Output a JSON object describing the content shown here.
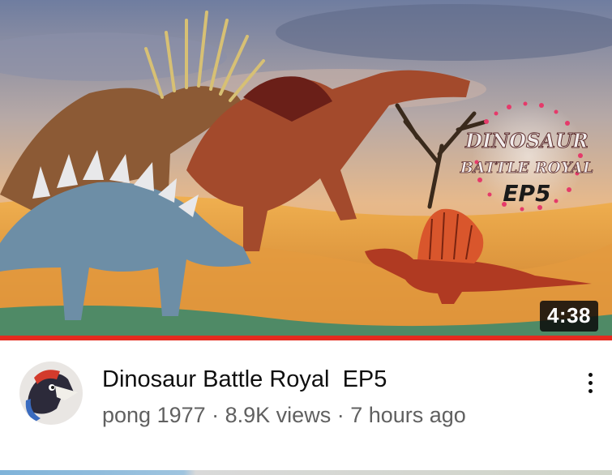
{
  "video": {
    "title": "Dinosaur Battle Royal  EP5",
    "duration": "4:38",
    "watch_progress": 1.0,
    "thumbnail_logo": {
      "line1": "DINOSAUR",
      "line2": "BATTLE ROYAL",
      "line3": "EP5"
    }
  },
  "channel": {
    "name": "pong 1977",
    "views": "8.9K views",
    "age": "7 hours ago",
    "separator": " · "
  },
  "icons": {
    "more": "vertical-ellipsis-icon"
  },
  "colors": {
    "progress": "#e52b1f",
    "title": "#0f0f0f",
    "subtext": "#606060"
  }
}
